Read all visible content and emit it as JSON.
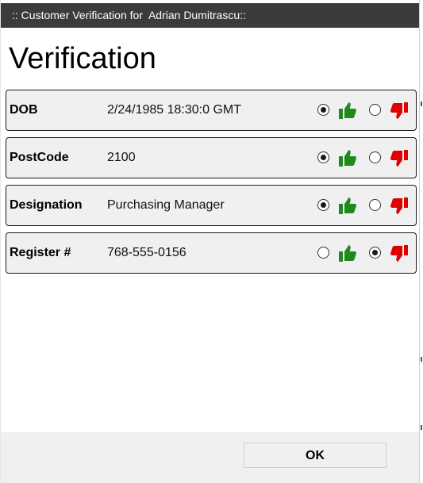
{
  "window": {
    "title": ":: Customer Verification for  Adrian Dumitrascu::"
  },
  "heading": "Verification",
  "rows": [
    {
      "label": "DOB",
      "value": "2/24/1985 18:30:0 GMT",
      "selection": "up"
    },
    {
      "label": "PostCode",
      "value": "2100",
      "selection": "up"
    },
    {
      "label": "Designation",
      "value": "Purchasing Manager",
      "selection": "up"
    },
    {
      "label": "Register #",
      "value": "768-555-0156",
      "selection": "down"
    }
  ],
  "icons": {
    "up": "thumbs-up-icon",
    "down": "thumbs-down-icon"
  },
  "colors": {
    "thumbs_up": "#1e8a1e",
    "thumbs_down": "#e00000",
    "titlebar": "#3b3b3b"
  },
  "footer": {
    "ok_label": "OK"
  }
}
